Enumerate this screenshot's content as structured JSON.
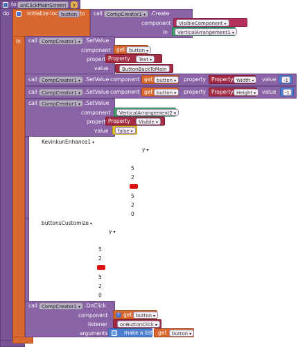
{
  "event": {
    "to": "to",
    "name": "onClickMainScreen",
    "param": "y",
    "do": "do"
  },
  "init_local": {
    "label": "initialize local",
    "var": "button",
    "to": "to",
    "call": "call",
    "comp": "CompCreator1",
    "method": ".Create",
    "component_label": "component",
    "component_value": "VisibleComponent",
    "component_type": "Button",
    "in_label": "in",
    "in_value": "VerticalArrangement1"
  },
  "in_label": "in",
  "set1": {
    "call": "call",
    "comp": "CompCreator1",
    "method": ".SetValue",
    "component_label": "component",
    "get": "get",
    "var": "button",
    "property_label": "property",
    "prop_kw": "Property",
    "prop": "Text",
    "value_label": "value",
    "value": "ButtonBackToMain"
  },
  "set2": {
    "call": "call",
    "comp": "CompCreator1",
    "method": ".SetValue",
    "component_label": "component",
    "get": "get",
    "var": "button",
    "property_label": "property",
    "prop_kw": "Property",
    "prop": "Width",
    "value_label": "value",
    "value": "-1"
  },
  "set3": {
    "call": "call",
    "comp": "CompCreator1",
    "method": ".SetValue",
    "component_label": "component",
    "get": "get",
    "var": "button",
    "property_label": "property",
    "prop_kw": "Property",
    "prop": "Height",
    "value_label": "value",
    "value": "-1"
  },
  "set4": {
    "call": "call",
    "comp": "CompCreator1",
    "method": ".SetValue",
    "component_label": "component",
    "component_value": "VerticalArrangement2",
    "property_label": "property",
    "prop_kw": "Property",
    "prop": "Visible",
    "value_label": "value",
    "value": "false"
  },
  "ext1": {
    "name": "KevinkunEnhance1",
    "y": "y",
    "numbers": [
      "5",
      "2",
      "5",
      "2",
      "0"
    ]
  },
  "ext2": {
    "name": "buttonsCustomize",
    "y": "y",
    "numbers": [
      "5",
      "2",
      "5",
      "2",
      "0"
    ]
  },
  "onclick": {
    "call": "call",
    "comp": "CompCreator1",
    "method": ".OnClick",
    "component_label": "component",
    "get": "get",
    "var": "button",
    "listener_label": "listener",
    "listener": "onButtonClick",
    "arguments_label": "arguments",
    "make_list": "make a list",
    "get2": "get",
    "var2": "button"
  },
  "colors": {
    "procedure": "#7a5496",
    "variable": "#d8682f",
    "text": "#b3315c",
    "component": "#3e9f6a",
    "number": "#4e7fd0",
    "logic": "#e0bf2e",
    "error": "#e01010"
  }
}
